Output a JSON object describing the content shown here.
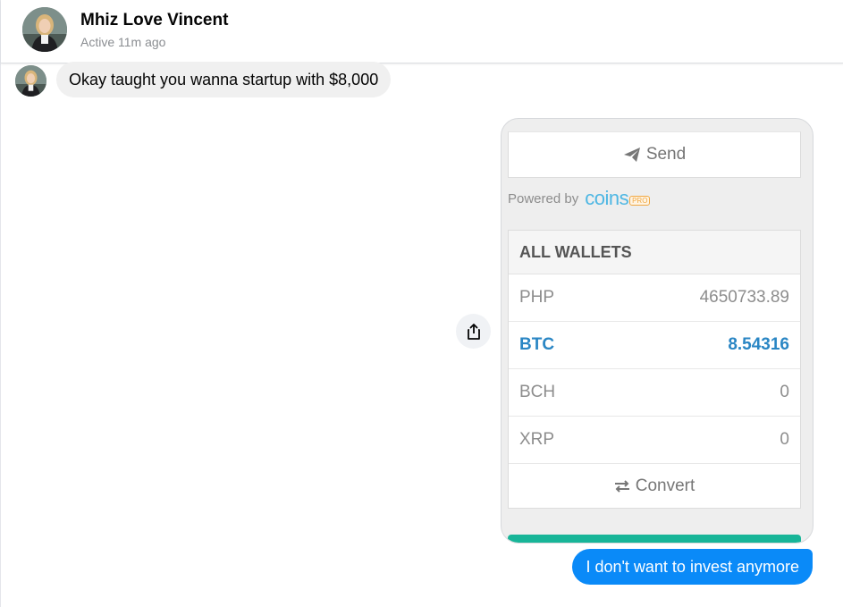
{
  "header": {
    "contact_name": "Mhiz Love Vincent",
    "status": "Active 11m ago"
  },
  "messages": {
    "incoming_text": "Okay taught you wanna startup with $8,000",
    "outgoing_text": "I don't want to invest anymore"
  },
  "attachment": {
    "send_label": "Send",
    "powered_by": "Powered by",
    "brand": "coins",
    "brand_tag": "PRO",
    "wallets_title": "ALL WALLETS",
    "wallets": [
      {
        "currency": "PHP",
        "balance": "4650733.89"
      },
      {
        "currency": "BTC",
        "balance": "8.54316"
      },
      {
        "currency": "BCH",
        "balance": "0"
      },
      {
        "currency": "XRP",
        "balance": "0"
      }
    ],
    "convert_label": "Convert"
  },
  "colors": {
    "outgoing_bubble": "#0a8af8",
    "incoming_bubble": "#f0f0f0",
    "active_wallet": "#2a86c4",
    "brand_blue": "#4fb7e3",
    "accent_green": "#17b598"
  },
  "icons": {
    "share": "share-icon",
    "send": "paper-plane-icon",
    "convert": "exchange-arrows-icon"
  }
}
